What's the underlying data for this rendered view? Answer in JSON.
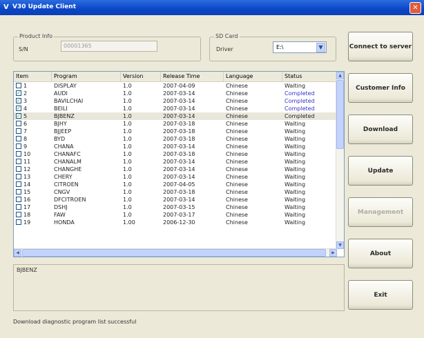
{
  "window": {
    "title": "V30 Update Client"
  },
  "product_info": {
    "legend": "Product Info",
    "sn_label": "S/N",
    "sn_value": "00001365"
  },
  "sd_card": {
    "legend": "SD Card",
    "driver_label": "Driver",
    "driver_value": "E:\\"
  },
  "table": {
    "columns": [
      "Item",
      "Program",
      "Version",
      "Release Time",
      "Language",
      "Status"
    ],
    "rows": [
      {
        "item": "1",
        "program": "DISPLAY",
        "version": "1.0",
        "release": "2007-04-09",
        "language": "Chinese",
        "status": "Waiting",
        "checked": false,
        "completed": false
      },
      {
        "item": "2",
        "program": "AUDI",
        "version": "1.0",
        "release": "2007-03-14",
        "language": "Chinese",
        "status": "Completed",
        "checked": true,
        "completed": true
      },
      {
        "item": "3",
        "program": "BAVILCHAI",
        "version": "1.0",
        "release": "2007-03-14",
        "language": "Chinese",
        "status": "Completed",
        "checked": true,
        "completed": true
      },
      {
        "item": "4",
        "program": "BEILI",
        "version": "1.0",
        "release": "2007-03-14",
        "language": "Chinese",
        "status": "Completed",
        "checked": true,
        "completed": true
      },
      {
        "item": "5",
        "program": "BJBENZ",
        "version": "1.0",
        "release": "2007-03-14",
        "language": "Chinese",
        "status": "Completed",
        "checked": true,
        "completed": false,
        "selected": true
      },
      {
        "item": "6",
        "program": "BJHY",
        "version": "1.0",
        "release": "2007-03-18",
        "language": "Chinese",
        "status": "Waiting",
        "checked": false,
        "completed": false
      },
      {
        "item": "7",
        "program": "BJJEEP",
        "version": "1.0",
        "release": "2007-03-18",
        "language": "Chinese",
        "status": "Waiting",
        "checked": false,
        "completed": false
      },
      {
        "item": "8",
        "program": "BYD",
        "version": "1.0",
        "release": "2007-03-18",
        "language": "Chinese",
        "status": "Waiting",
        "checked": false,
        "completed": false
      },
      {
        "item": "9",
        "program": "CHANA",
        "version": "1.0",
        "release": "2007-03-14",
        "language": "Chinese",
        "status": "Waiting",
        "checked": false,
        "completed": false
      },
      {
        "item": "10",
        "program": "CHANAFC",
        "version": "1.0",
        "release": "2007-03-18",
        "language": "Chinese",
        "status": "Waiting",
        "checked": false,
        "completed": false
      },
      {
        "item": "11",
        "program": "CHANALM",
        "version": "1.0",
        "release": "2007-03-14",
        "language": "Chinese",
        "status": "Waiting",
        "checked": false,
        "completed": false
      },
      {
        "item": "12",
        "program": "CHANGHE",
        "version": "1.0",
        "release": "2007-03-14",
        "language": "Chinese",
        "status": "Waiting",
        "checked": false,
        "completed": false
      },
      {
        "item": "13",
        "program": "CHERY",
        "version": "1.0",
        "release": "2007-03-14",
        "language": "Chinese",
        "status": "Waiting",
        "checked": false,
        "completed": false
      },
      {
        "item": "14",
        "program": "CITROEN",
        "version": "1.0",
        "release": "2007-04-05",
        "language": "Chinese",
        "status": "Waiting",
        "checked": false,
        "completed": false
      },
      {
        "item": "15",
        "program": "CNGV",
        "version": "1.0",
        "release": "2007-03-18",
        "language": "Chinese",
        "status": "Waiting",
        "checked": false,
        "completed": false
      },
      {
        "item": "16",
        "program": "DFCITROEN",
        "version": "1.0",
        "release": "2007-03-14",
        "language": "Chinese",
        "status": "Waiting",
        "checked": false,
        "completed": false
      },
      {
        "item": "17",
        "program": "DSHJ",
        "version": "1.0",
        "release": "2007-03-15",
        "language": "Chinese",
        "status": "Waiting",
        "checked": false,
        "completed": false
      },
      {
        "item": "18",
        "program": "FAW",
        "version": "1.0",
        "release": "2007-03-17",
        "language": "Chinese",
        "status": "Waiting",
        "checked": false,
        "completed": false
      },
      {
        "item": "19",
        "program": "HONDA",
        "version": "1.00",
        "release": "2006-12-30",
        "language": "Chinese",
        "status": "Waiting",
        "checked": false,
        "completed": false
      }
    ]
  },
  "description": {
    "text": "BJBENZ"
  },
  "status_bar": {
    "text": "Download diagnostic program list successful"
  },
  "buttons": {
    "connect": "Connect to server",
    "customer": "Customer Info",
    "download": "Download",
    "update": "Update",
    "management": "Management",
    "about": "About",
    "exit": "Exit"
  },
  "colors": {
    "completed": "#3333cc",
    "checked_mark": "#21a121",
    "title_blue": "#0a46c8"
  }
}
